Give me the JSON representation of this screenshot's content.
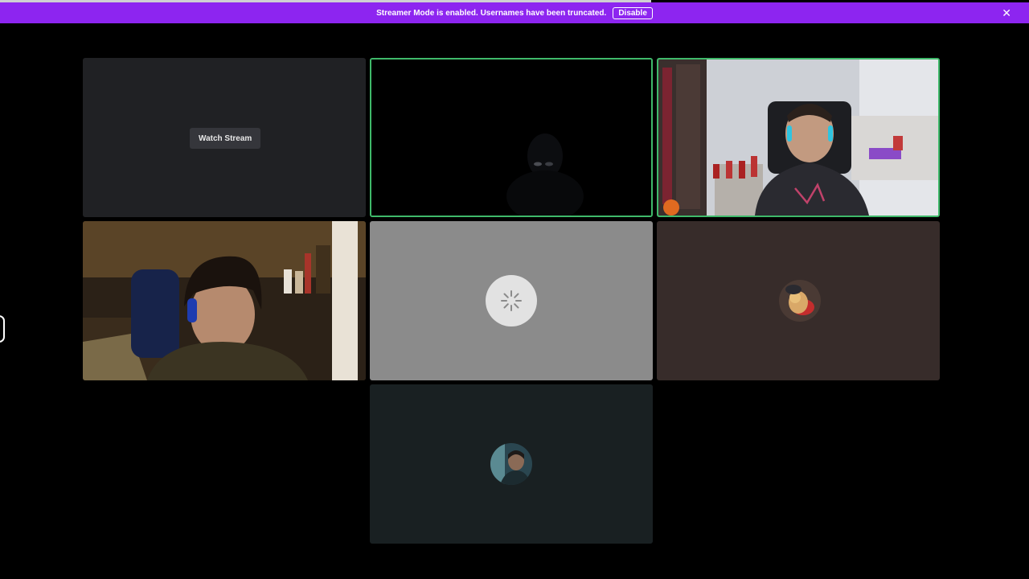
{
  "notice": {
    "text": "Streamer Mode is enabled. Usernames have been truncated.",
    "disable_label": "Disable",
    "close_icon": "close-icon",
    "background": "#8d25f0"
  },
  "tiles": [
    {
      "id": "stream-tile",
      "button_label": "Watch Stream"
    },
    {
      "id": "video-tile-dark",
      "speaking": true
    },
    {
      "id": "video-tile-bedroom",
      "speaking": true
    },
    {
      "id": "video-tile-headset"
    },
    {
      "id": "loading-tile",
      "icon": "spinner-icon"
    },
    {
      "id": "avatar-tile-brown",
      "icon": "user-avatar"
    },
    {
      "id": "avatar-tile-teal",
      "icon": "user-avatar"
    }
  ],
  "colors": {
    "background": "#000000",
    "speaking_ring": "#3fb96a"
  }
}
